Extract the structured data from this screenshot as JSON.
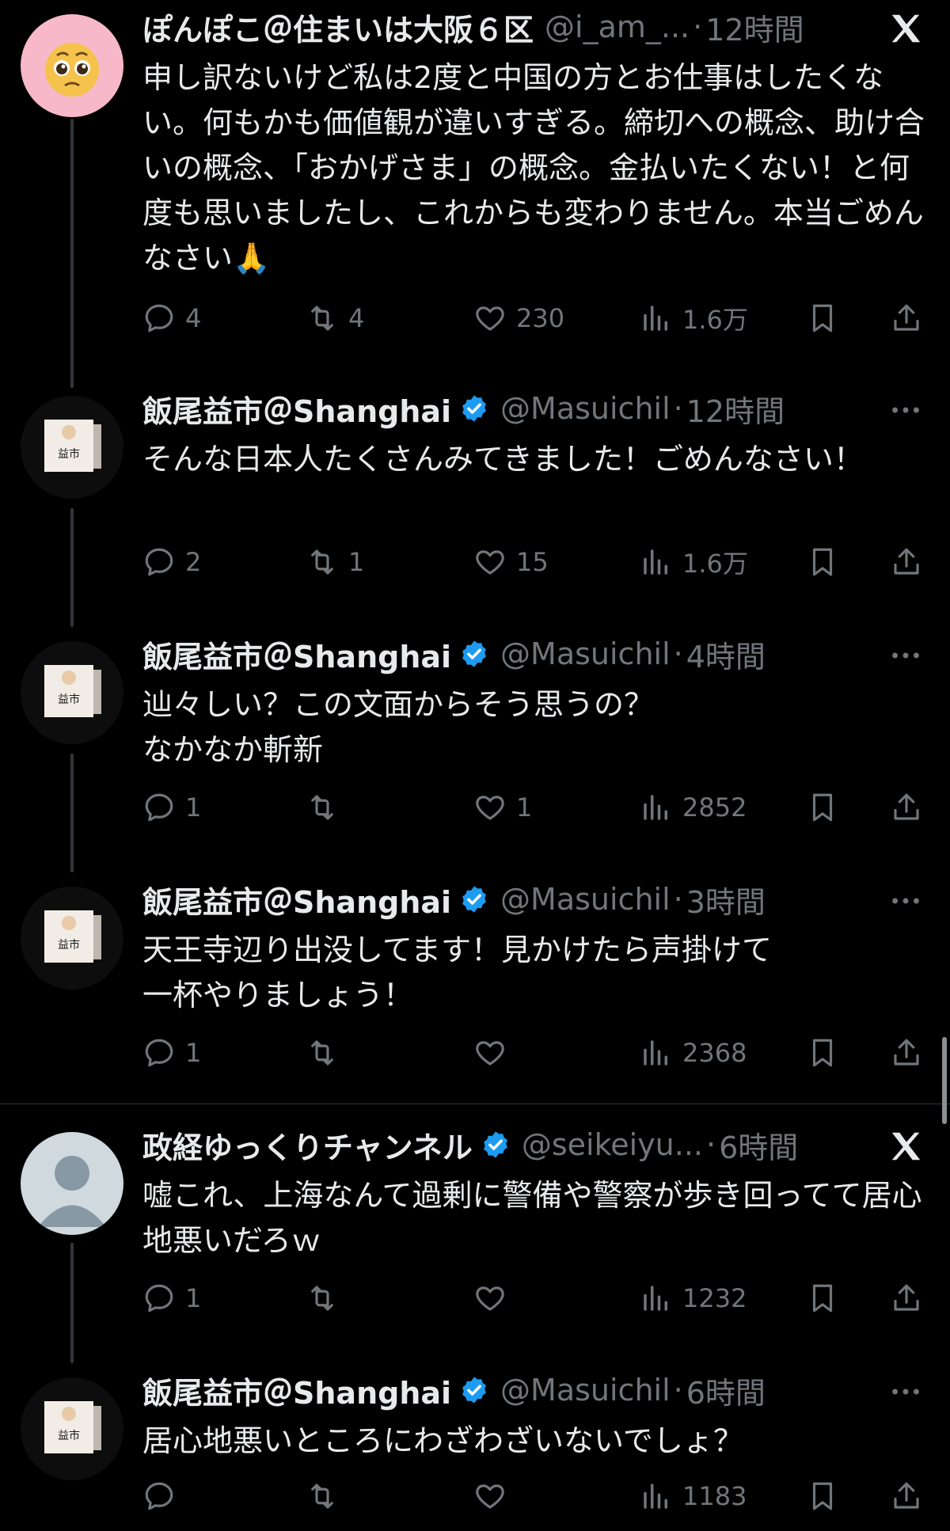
{
  "tweets": [
    {
      "name": "ぽんぽこ＠住まいは大阪６区",
      "handle": "@i_am_...",
      "time": "12時間",
      "text": "申し訳ないけど私は2度と中国の方とお仕事はしたくない。何もかも価値観が違いすぎる。締切への概念、助け合いの概念、「おかげさま」の概念。金払いたくない！と何度も思いましたし、これからも変わりません。本当ごめんなさい🙏",
      "replies": "4",
      "retweets": "4",
      "likes": "230",
      "views": "1.6万",
      "avatar": "pleading-emoji-avatar",
      "corner": "x-logo-icon"
    },
    {
      "name": "飯尾益市＠Shanghai",
      "handle": "@Masuichil",
      "time": "12時間",
      "text": "そんな日本人たくさんみてきました！ごめんなさい！",
      "replies": "2",
      "retweets": "1",
      "likes": "15",
      "views": "1.6万",
      "avatar": "sign-box-avatar",
      "corner": "more-icon"
    },
    {
      "name": "飯尾益市＠Shanghai",
      "handle": "@Masuichil",
      "time": "4時間",
      "text": "辿々しい？この文面からそう思うの？\nなかなか斬新",
      "replies": "1",
      "retweets": "",
      "likes": "1",
      "views": "2852",
      "avatar": "sign-box-avatar",
      "corner": "more-icon"
    },
    {
      "name": "飯尾益市＠Shanghai",
      "handle": "@Masuichil",
      "time": "3時間",
      "text": "天王寺辺り出没してます！見かけたら声掛けて\n一杯やりましょう！",
      "replies": "1",
      "retweets": "",
      "likes": "",
      "views": "2368",
      "avatar": "sign-box-avatar",
      "corner": "more-icon"
    },
    {
      "name": "政経ゆっくりチャンネル",
      "handle": "@seikeiyu...",
      "time": "6時間",
      "text": "嘘これ、上海なんて過剰に警備や警察が歩き回ってて居心地悪いだろｗ",
      "replies": "1",
      "retweets": "",
      "likes": "",
      "views": "1232",
      "avatar": "default-user-avatar",
      "corner": "x-logo-icon"
    },
    {
      "name": "飯尾益市＠Shanghai",
      "handle": "@Masuichil",
      "time": "6時間",
      "text": "居心地悪いところにわざわざいないでしょ？",
      "replies": "",
      "retweets": "",
      "likes": "",
      "views": "1183",
      "avatar": "sign-box-avatar",
      "corner": "more-icon"
    }
  ],
  "avatar_sign_text": "益市",
  "colors": {
    "background": "#000000",
    "text": "#e7e9ea",
    "muted": "#71767b",
    "verified": "#1d9bf0",
    "thread_line": "#333639"
  }
}
